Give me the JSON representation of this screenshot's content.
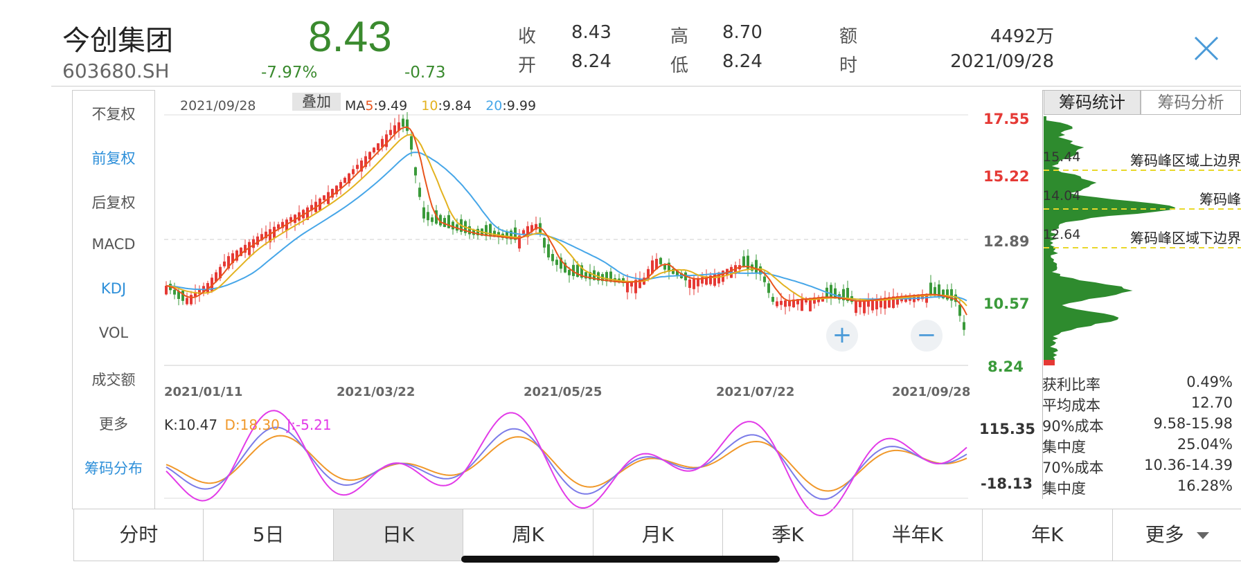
{
  "stock": {
    "name": "今创集团",
    "code": "603680.SH",
    "price": "8.43",
    "change_pct": "-7.97%",
    "change": "-0.73"
  },
  "quote": {
    "close_label": "收",
    "close": "8.43",
    "open_label": "开",
    "open": "8.24",
    "high_label": "高",
    "high": "8.70",
    "low_label": "低",
    "low": "8.24",
    "amount_label": "额",
    "amount": "4492万",
    "time_label": "时",
    "time": "2021/09/28"
  },
  "left_menu": [
    "不复权",
    "前复权",
    "后复权",
    "MACD",
    "KDJ",
    "VOL",
    "成交额",
    "更多",
    "筹码分布"
  ],
  "left_menu_active": [
    "前复权",
    "KDJ",
    "筹码分布"
  ],
  "main_chart": {
    "date_label": "2021/09/28",
    "overlay_label": "叠加",
    "ma_prefix": "MA",
    "ma5_label": "5",
    "ma5_value": ":9.49",
    "ma10_label": "10",
    "ma10_value": ":9.84",
    "ma20_label": "20",
    "ma20_value": ":9.99",
    "y_ticks": [
      "17.55",
      "15.22",
      "12.89",
      "10.57",
      "8.24"
    ],
    "x_ticks": [
      "2021/01/11",
      "2021/03/22",
      "2021/05/25",
      "2021/07/22",
      "2021/09/28"
    ],
    "zoom_in": "+",
    "zoom_out": "−"
  },
  "kdj": {
    "k_label": "K:10.47",
    "d_label": "D:18.30",
    "j_label": "J:-5.21",
    "y_max": "115.35",
    "y_min": "-18.13"
  },
  "chip": {
    "tab_stats": "筹码统计",
    "tab_analysis": "筹码分析",
    "upper_value": "15.44",
    "upper_label": "筹码峰区域上边界",
    "peak_value": "14.04",
    "peak_label": "筹码峰",
    "lower_value": "12.64",
    "lower_label": "筹码峰区域下边界",
    "stats": [
      {
        "label": "获利比率",
        "value": "0.49%"
      },
      {
        "label": "平均成本",
        "value": "12.70"
      },
      {
        "label": "90%成本",
        "value": "9.58-15.98"
      },
      {
        "label": "集中度",
        "value": "25.04%"
      },
      {
        "label": "70%成本",
        "value": "10.36-14.39"
      },
      {
        "label": "集中度",
        "value": "16.28%"
      }
    ]
  },
  "bottom_tabs": [
    "分时",
    "5日",
    "日K",
    "周K",
    "月K",
    "季K",
    "半年K",
    "年K",
    "更多"
  ],
  "bottom_tab_active": "日K",
  "colors": {
    "up": "#e53935",
    "down": "#3a9a3a",
    "ma5": "#e8541c",
    "ma10": "#e3b21f",
    "ma20": "#46a6e8",
    "k": "#7b7be8",
    "d": "#f0982a",
    "j": "#e23be8",
    "chip": "#2e8b2e"
  }
}
